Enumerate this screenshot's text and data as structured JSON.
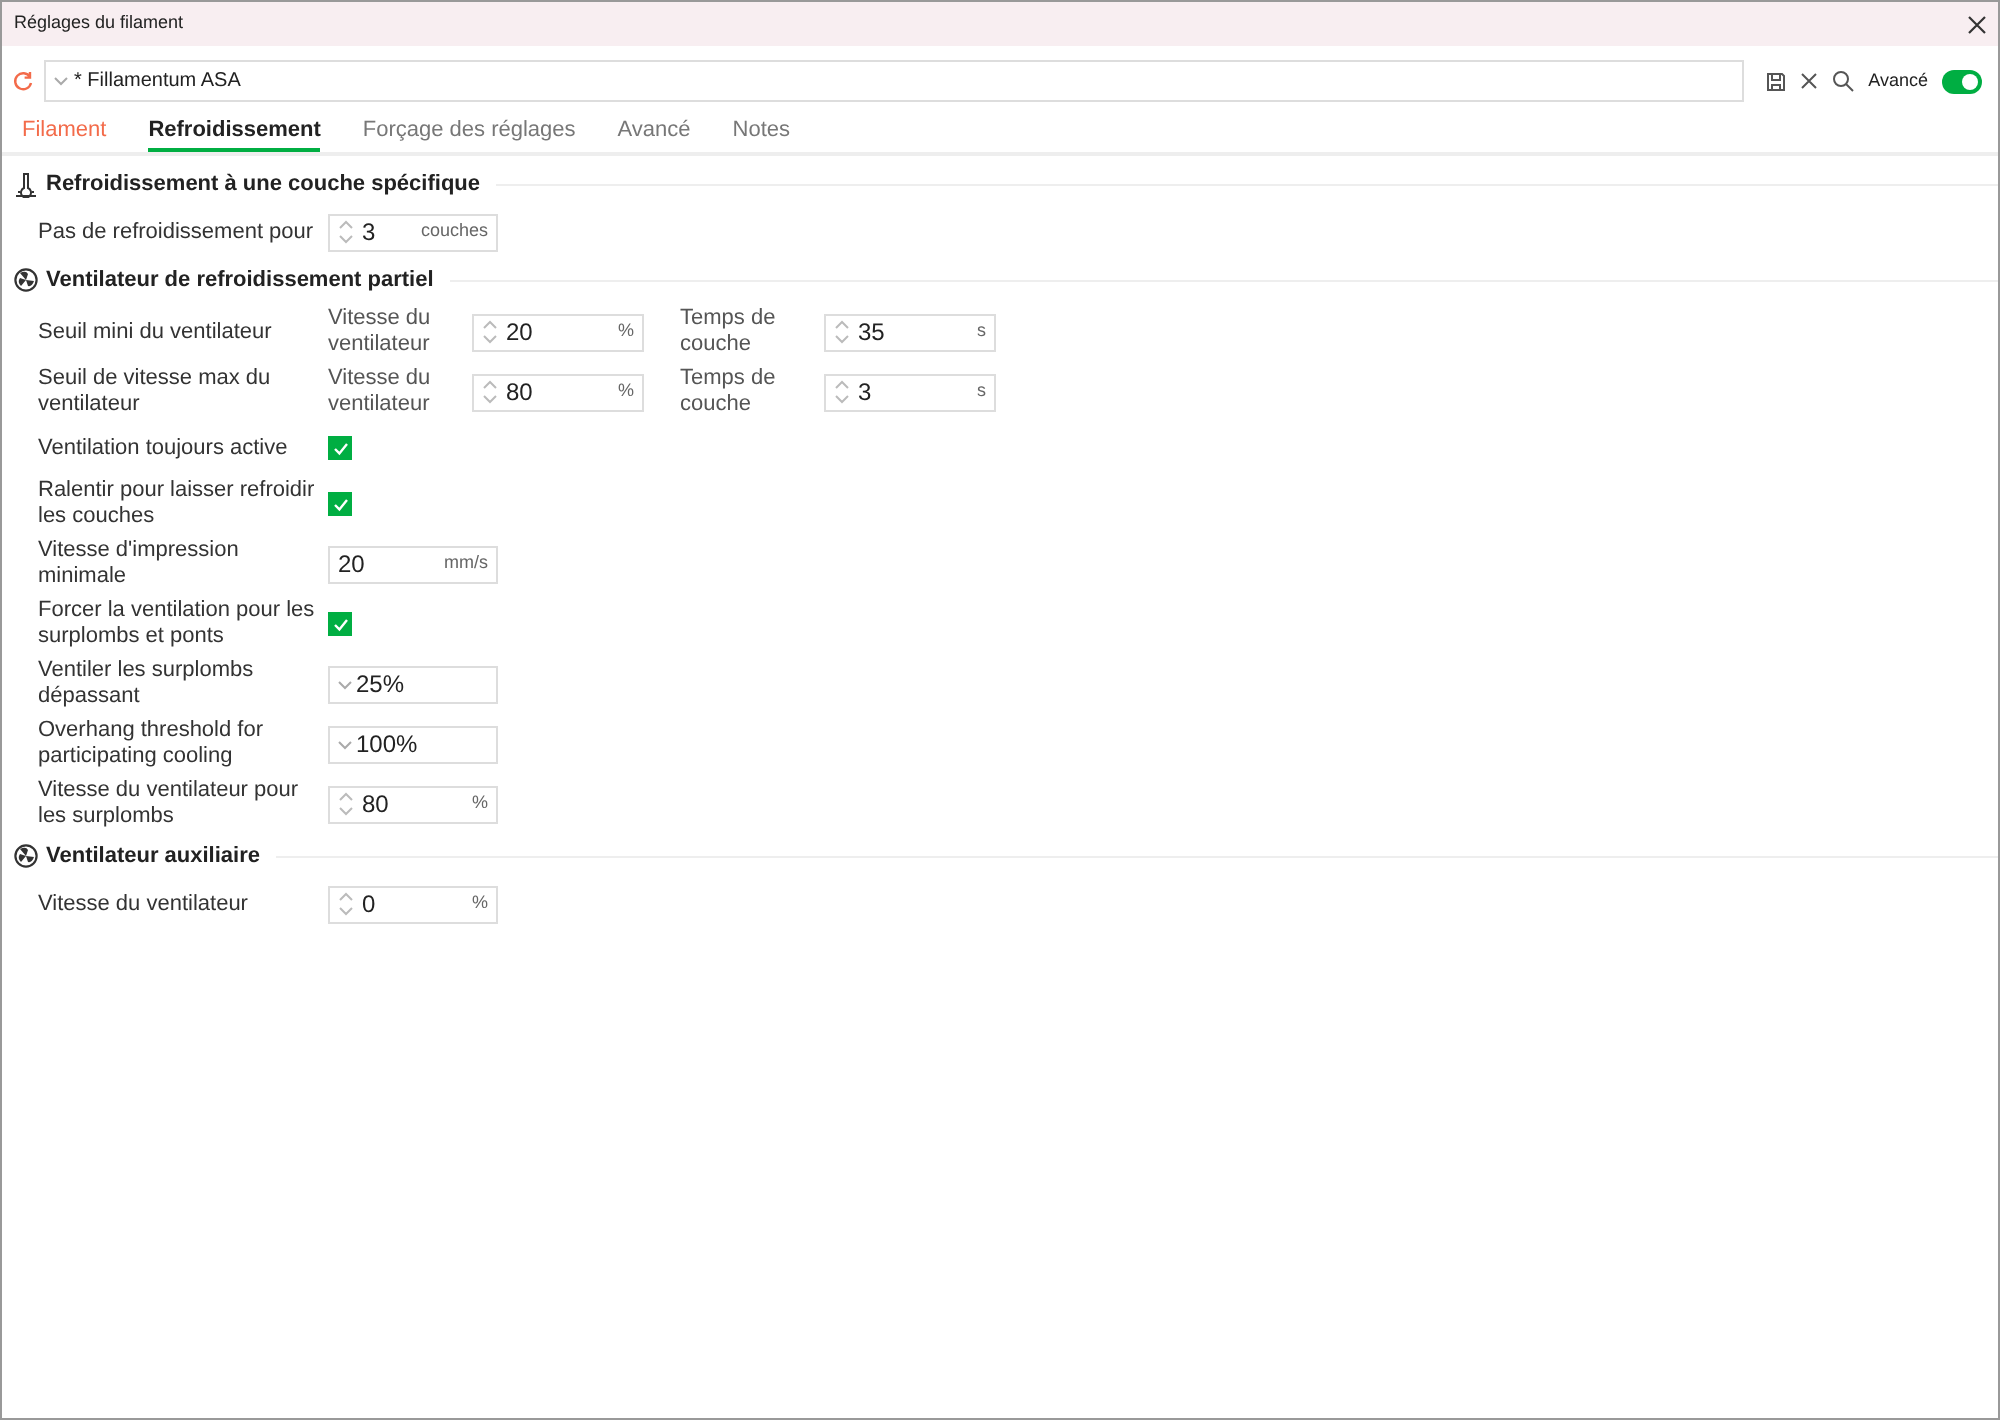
{
  "window": {
    "title": "Réglages du filament"
  },
  "preset": {
    "value": "* Fillamentum ASA"
  },
  "toolbar": {
    "advanced_label": "Avancé",
    "advanced_on": true
  },
  "tabs": [
    {
      "label": "Filament",
      "selected": false,
      "modified": true
    },
    {
      "label": "Refroidissement",
      "selected": true,
      "modified": false
    },
    {
      "label": "Forçage des réglages",
      "selected": false,
      "modified": false
    },
    {
      "label": "Avancé",
      "selected": false,
      "modified": false
    },
    {
      "label": "Notes",
      "selected": false,
      "modified": false
    }
  ],
  "sections": [
    {
      "title": "Refroidissement à une couche spécifique",
      "rows": [
        {
          "kind": "fields",
          "label": "Pas de refroidissement pour",
          "fields": [
            {
              "value": "3",
              "unit": "couches",
              "spinner": true
            }
          ]
        }
      ]
    },
    {
      "title": "Ventilateur de refroidissement partiel",
      "rows": [
        {
          "kind": "fields",
          "label": "Seuil mini du ventilateur",
          "fields": [
            {
              "caption": "Vitesse du ventilateur",
              "value": "20",
              "unit": "%",
              "spinner": true
            },
            {
              "caption": "Temps de couche",
              "value": "35",
              "unit": "s",
              "spinner": true
            }
          ]
        },
        {
          "kind": "fields",
          "label": "Seuil de vitesse max du ventilateur",
          "fields": [
            {
              "caption": "Vitesse du ventilateur",
              "value": "80",
              "unit": "%",
              "spinner": true
            },
            {
              "caption": "Temps de couche",
              "value": "3",
              "unit": "s",
              "spinner": true
            }
          ]
        },
        {
          "kind": "check",
          "label": "Ventilation toujours active",
          "checked": true
        },
        {
          "kind": "check",
          "label": "Ralentir pour laisser refroidir les couches",
          "checked": true
        },
        {
          "kind": "fields",
          "label": "Vitesse d'impression minimale",
          "fields": [
            {
              "value": "20",
              "unit": "mm/s",
              "spinner": false
            }
          ]
        },
        {
          "kind": "check",
          "label": "Forcer la ventilation pour les surplombs et ponts",
          "checked": true
        },
        {
          "kind": "combo",
          "label": "Ventiler les surplombs dépassant",
          "value": "25%"
        },
        {
          "kind": "combo",
          "label": "Overhang threshold for participating cooling",
          "value": "100%"
        },
        {
          "kind": "fields",
          "label": "Vitesse du ventilateur pour les surplombs",
          "fields": [
            {
              "value": "80",
              "unit": "%",
              "spinner": true
            }
          ]
        }
      ]
    },
    {
      "title": "Ventilateur auxiliaire",
      "rows": [
        {
          "kind": "fields",
          "label": "Vitesse du ventilateur",
          "fields": [
            {
              "value": "0",
              "unit": "%",
              "spinner": true
            }
          ]
        }
      ]
    }
  ]
}
